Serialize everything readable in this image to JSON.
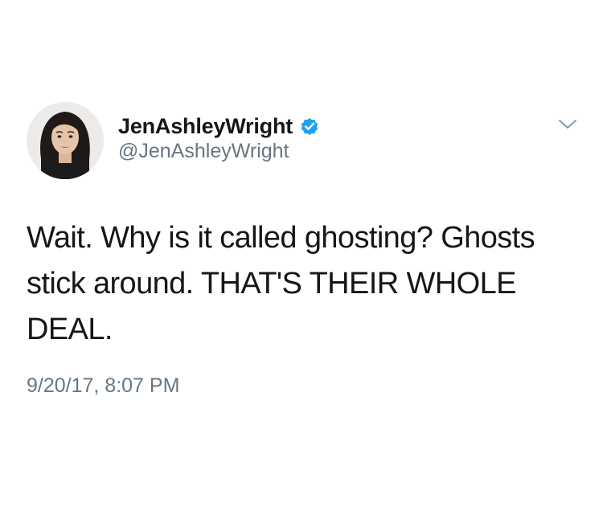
{
  "tweet": {
    "author": {
      "display_name": "JenAshleyWright",
      "handle": "@JenAshleyWright",
      "verified": true,
      "avatar_icon": "profile-photo"
    },
    "text": "Wait. Why is it called ghosting? Ghosts\nstick around. THAT'S THEIR WHOLE\nDEAL.",
    "timestamp": "9/20/17, 8:07 PM",
    "menu_icon": "chevron-down-icon"
  },
  "colors": {
    "text": "#14171a",
    "secondary_text": "#657786",
    "verified_badge": "#1da1f2",
    "background": "#ffffff"
  }
}
